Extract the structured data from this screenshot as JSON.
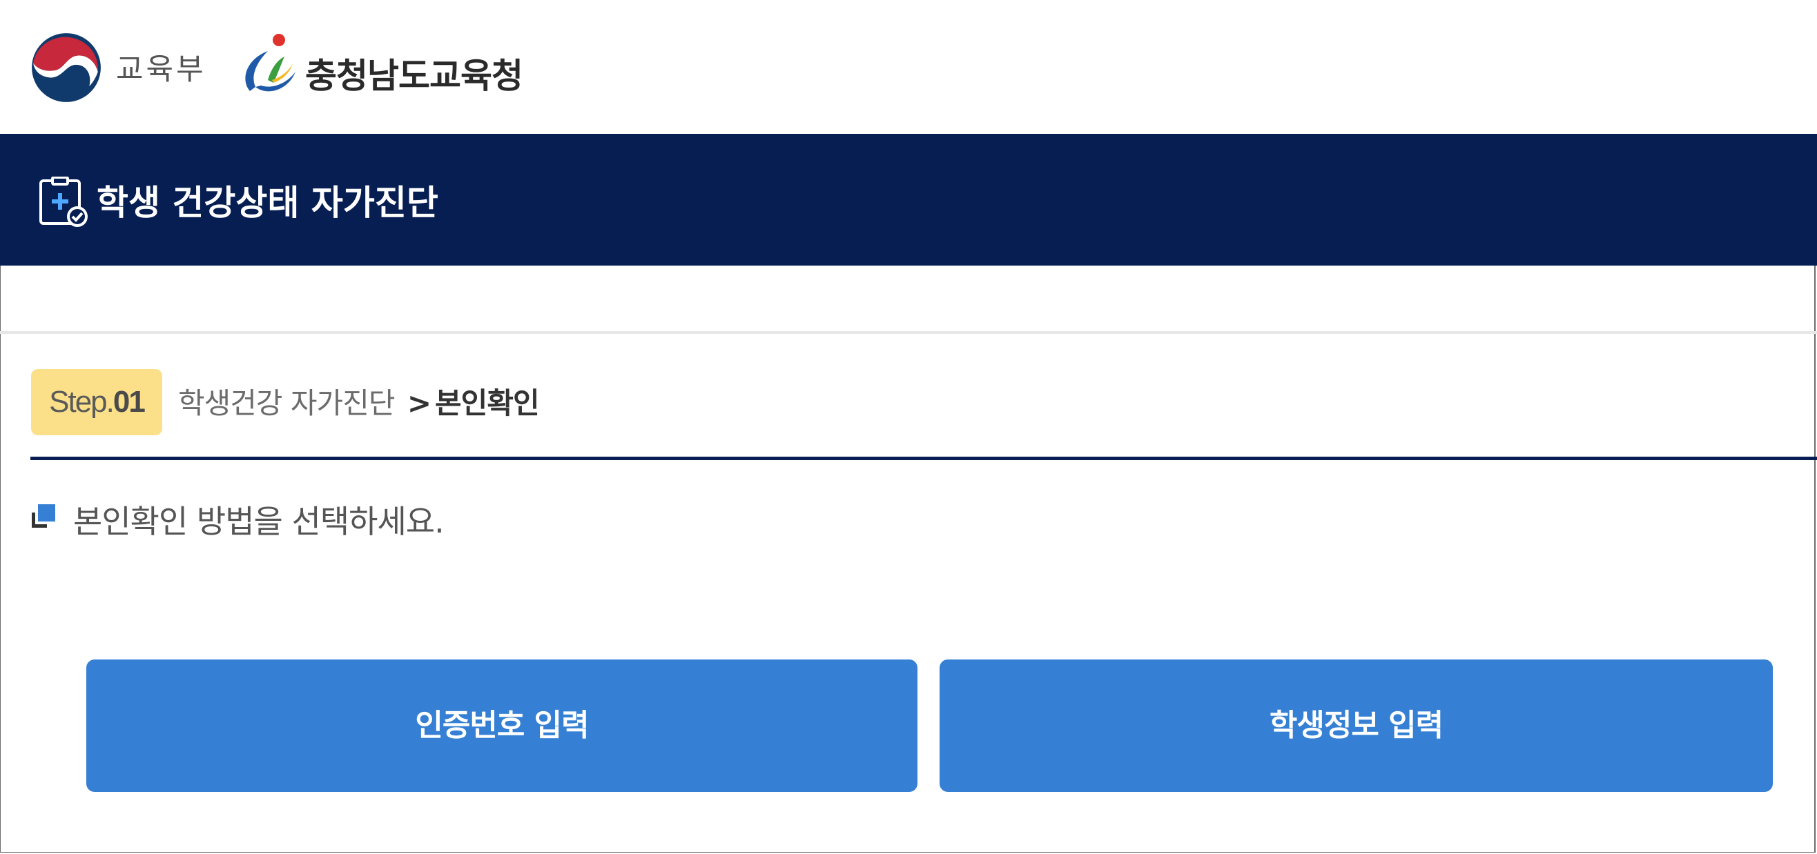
{
  "header": {
    "ministry_name": "교육부",
    "office_name": "충청남도교육청"
  },
  "title_band": {
    "title": "학생 건강상태 자가진단"
  },
  "step": {
    "badge_prefix": "Step.",
    "badge_number": "01",
    "breadcrumb_parent": "학생건강 자가진단",
    "breadcrumb_separator": ">",
    "breadcrumb_current": "본인확인"
  },
  "instruction": {
    "text": "본인확인 방법을 선택하세요."
  },
  "buttons": {
    "auth_code_label": "인증번호 입력",
    "student_info_label": "학생정보 입력"
  },
  "colors": {
    "title_band_bg": "#061e52",
    "step_badge_bg": "#fbe089",
    "button_bg": "#3580d4",
    "bullet_accent": "#3580d4"
  },
  "icons": {
    "ministry_logo": "korean-government-taegeuk-emblem",
    "office_logo": "chungnam-education-office-emblem",
    "title_icon": "clipboard-plus-check-icon",
    "bullet_icon": "square-bullet-icon"
  }
}
